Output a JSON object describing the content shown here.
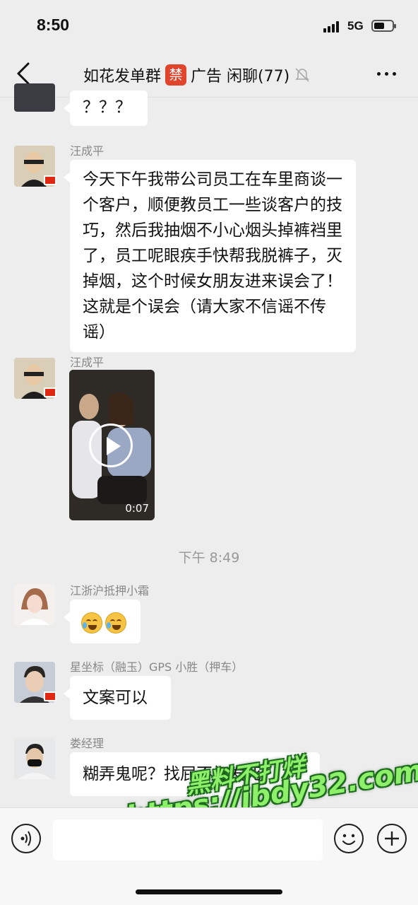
{
  "status_bar": {
    "time": "8:50",
    "network": "5G"
  },
  "header": {
    "title": "如花发单群",
    "badge": "禁",
    "title_suffix": "广告 闲聊(77)"
  },
  "messages": [
    {
      "text": "？？？"
    },
    {
      "sender": "汪成平",
      "text": "今天下午我带公司员工在车里商谈一个客户，顺便教员工一些谈客户的技巧，然后我抽烟不小心烟头掉裤裆里了，员工呢眼疾手快帮我脱裤子，灭掉烟，这个时候女朋友进来误会了！这就是个误会（请大家不信谣不传谣）"
    },
    {
      "sender": "汪成平",
      "video_duration": "0:07"
    },
    {
      "sender": "江浙沪抵押小霜"
    },
    {
      "sender": "星坐标（融玉）GPS 小胜（押车）",
      "text": "文案可以"
    },
    {
      "sender": "娄经理",
      "text": "糊弄鬼呢？找屁不打发死"
    }
  ],
  "time_separator": "下午 8:49",
  "watermark": {
    "line1": "黑料不打烊",
    "line2": "https://ibdy32.com"
  },
  "colors": {
    "background": "#ededed",
    "bubble": "#ffffff",
    "badge": "#e0442d",
    "watermark": "#8ef06a"
  },
  "icons": [
    "back-icon",
    "mute-icon",
    "more-icon",
    "play-icon",
    "voice-icon",
    "emoji-icon",
    "plus-icon"
  ]
}
